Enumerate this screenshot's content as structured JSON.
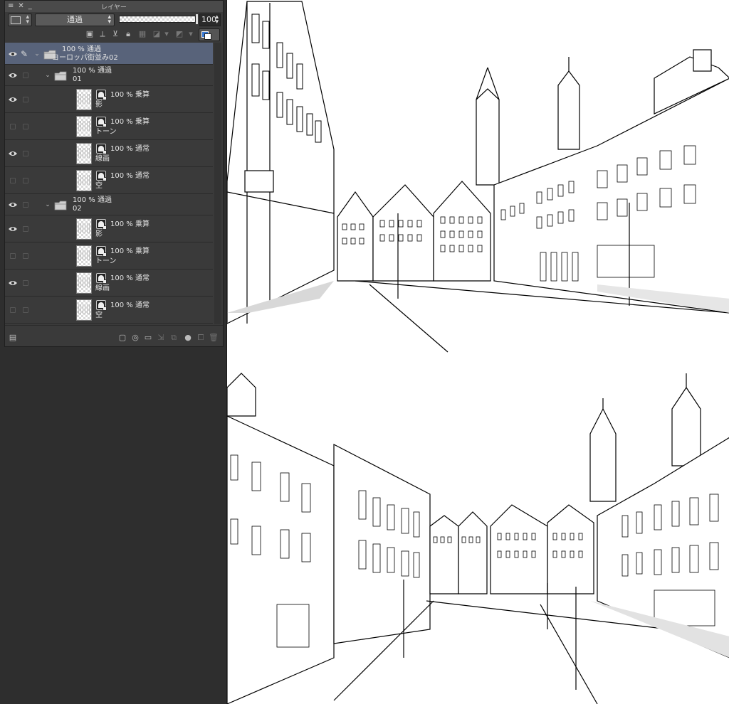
{
  "panel": {
    "title": "レイヤー",
    "blend_mode": "通過",
    "opacity_value": "100",
    "opacity_fraction": 1.0
  },
  "layers": [
    {
      "id": "root",
      "visible": true,
      "editing": true,
      "type": "folder",
      "expanded": true,
      "line1": "100 % 通過",
      "line2": "ヨーロッパ街並み02",
      "selected": true
    },
    {
      "id": "f01",
      "visible": true,
      "type": "folder",
      "expanded": true,
      "line1": "100 % 通過",
      "line2": "01"
    },
    {
      "id": "f01-shadow",
      "visible": true,
      "type": "raster",
      "line1": "100 % 乗算",
      "line2": "影"
    },
    {
      "id": "f01-tone",
      "visible": false,
      "type": "raster",
      "line1": "100 % 乗算",
      "line2": "トーン"
    },
    {
      "id": "f01-line",
      "visible": true,
      "type": "raster",
      "line1": "100 % 通常",
      "line2": "線画"
    },
    {
      "id": "f01-sky",
      "visible": false,
      "type": "raster",
      "line1": "100 % 通常",
      "line2": "空"
    },
    {
      "id": "f02",
      "visible": true,
      "type": "folder",
      "expanded": true,
      "line1": "100 % 通過",
      "line2": "02"
    },
    {
      "id": "f02-shadow",
      "visible": true,
      "type": "raster",
      "line1": "100 % 乗算",
      "line2": "影"
    },
    {
      "id": "f02-tone",
      "visible": false,
      "type": "raster",
      "line1": "100 % 乗算",
      "line2": "トーン"
    },
    {
      "id": "f02-line",
      "visible": true,
      "type": "raster",
      "line1": "100 % 通常",
      "line2": "線画"
    },
    {
      "id": "f02-sky",
      "visible": false,
      "type": "raster",
      "line1": "100 % 通常",
      "line2": "空"
    }
  ],
  "toolbar_icons": [
    "layer-tone-icon",
    "ruler-icon",
    "clip-icon",
    "lock-icon",
    "lock-transparent-icon",
    "mask-icon",
    "reference-icon",
    "palette-color-icon"
  ],
  "bottom_icons": [
    "new-raster-layer-icon",
    "new-vector-layer-icon",
    "new-folder-icon",
    "transfer-icon",
    "merge-icon",
    "mask-add-icon",
    "duplicate-icon",
    "delete-icon"
  ],
  "colors": {
    "panel_bg": "#3a3a3a",
    "selected_row": "#58637a",
    "canvas_bg": "#ffffff",
    "accent_blue": "#3a7bd5"
  }
}
